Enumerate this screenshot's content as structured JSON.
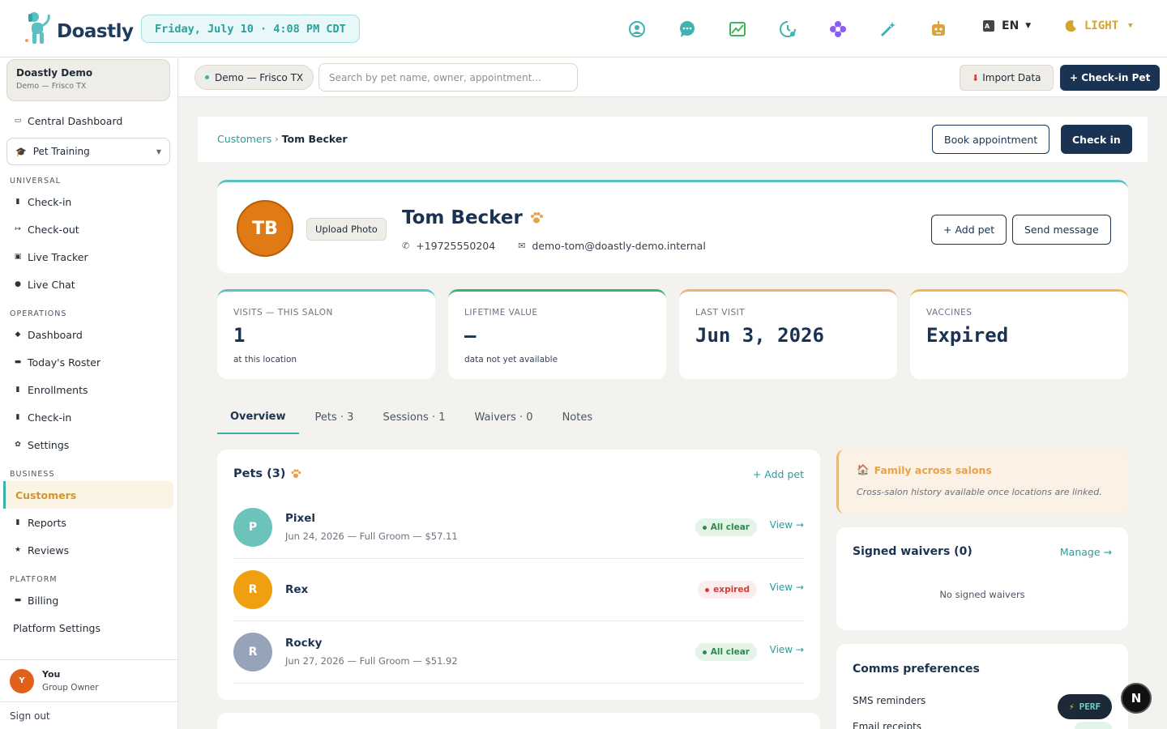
{
  "app": {
    "name": "Doastly"
  },
  "topbar": {
    "datetime": "Friday, July 10 · 4:08 PM CDT",
    "icons": [
      "user-circle-icon",
      "chat-bubble-icon",
      "chart-image-icon",
      "clock-refresh-icon",
      "flower-icon",
      "magic-wand-icon",
      "robot-icon"
    ],
    "language": "EN",
    "theme": "LIGHT"
  },
  "sidebar": {
    "org_name": "Doastly Demo",
    "org_location": "Demo — Frisco TX",
    "central_dashboard": "Central Dashboard",
    "module": "Pet Training",
    "sections": {
      "universal": "UNIVERSAL",
      "operations": "OPERATIONS",
      "business": "BUSINESS",
      "platform": "PLATFORM"
    },
    "universal_items": [
      "Check-in",
      "Check-out",
      "Live Tracker",
      "Live Chat"
    ],
    "operations_items": [
      "Dashboard",
      "Today's Roster",
      "Enrollments",
      "Check-in",
      "Settings"
    ],
    "business_items": [
      "Customers",
      "Reports",
      "Reviews"
    ],
    "platform_items": [
      "Billing",
      "Platform Settings"
    ],
    "user": {
      "initial": "Y",
      "name": "You",
      "role": "Group Owner"
    },
    "sign_out": "Sign out"
  },
  "subbar": {
    "location": "Demo — Frisco TX",
    "search_placeholder": "Search by pet name, owner, appointment...",
    "import_label": "Import Data",
    "checkin_pet_label": "+ Check-in Pet"
  },
  "breadcrumb": {
    "parent": "Customers",
    "separator": "›",
    "current": "Tom Becker"
  },
  "actions": {
    "book": "Book appointment",
    "checkin": "Check in"
  },
  "customer": {
    "initials": "TB",
    "upload_photo": "Upload Photo",
    "name": "Tom Becker",
    "phone": "+19725550204",
    "email": "demo-tom@doastly-demo.internal",
    "add_pet": "+ Add pet",
    "send_message": "Send message"
  },
  "stats": [
    {
      "label": "VISITS — THIS SALON",
      "value": "1",
      "sub": "at this location",
      "accent": "#58c2c2"
    },
    {
      "label": "LIFETIME VALUE",
      "value": "—",
      "sub": "data not yet available",
      "accent": "#3cb371"
    },
    {
      "label": "LAST VISIT",
      "value": "Jun 3, 2026",
      "sub": "",
      "accent": "#f0b27a"
    },
    {
      "label": "VACCINES",
      "value": "Expired",
      "sub": "",
      "accent": "#f2b84b"
    }
  ],
  "tabs": [
    "Overview",
    "Pets · 3",
    "Sessions · 1",
    "Waivers · 0",
    "Notes"
  ],
  "pets_card": {
    "title": "Pets (3)",
    "add_link": "+ Add pet",
    "view_label": "View →",
    "pets": [
      {
        "initial": "P",
        "name": "Pixel",
        "meta": "Jun 24, 2026 — Full Groom — $57.11",
        "status": "All clear",
        "color": "#6cc3b9"
      },
      {
        "initial": "R",
        "name": "Rex",
        "meta": "",
        "status": "expired",
        "color": "#f0a00e"
      },
      {
        "initial": "R",
        "name": "Rocky",
        "meta": "Jun 27, 2026 — Full Groom — $51.92",
        "status": "All clear",
        "color": "#97a3b8"
      }
    ]
  },
  "family": {
    "title": "Family across salons",
    "text": "Cross-salon history available once locations are linked."
  },
  "waivers": {
    "title": "Signed waivers (0)",
    "manage": "Manage →",
    "empty": "No signed waivers"
  },
  "comms": {
    "title": "Comms preferences",
    "rows": [
      "SMS reminders",
      "Email receipts"
    ]
  },
  "dev": {
    "perf": "PERF",
    "badge": "N"
  },
  "colors": {
    "brand": "#1a3352",
    "accent": "#38b2ac",
    "warning": "#e7a24a"
  }
}
